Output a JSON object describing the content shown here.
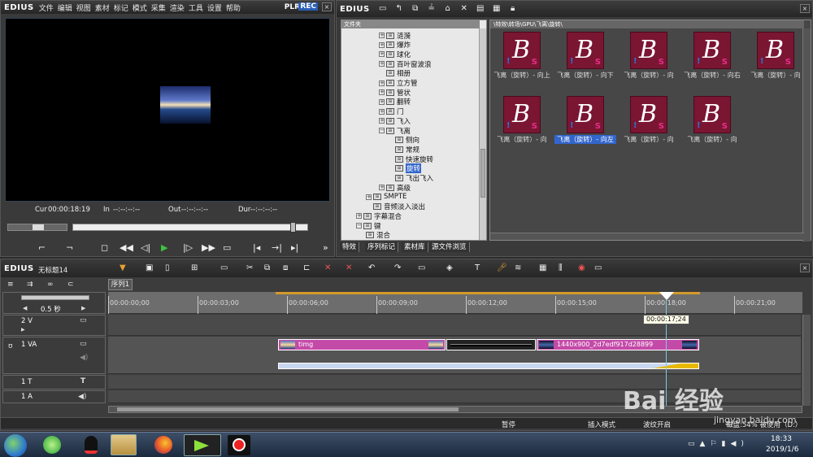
{
  "app": {
    "logo": "EDIUS"
  },
  "player": {
    "menu": [
      "文件",
      "编辑",
      "视图",
      "素材",
      "标记",
      "模式",
      "采集",
      "渲染",
      "工具",
      "设置",
      "帮助"
    ],
    "plr": "PLR",
    "rec": "REC",
    "cur_label": "Cur",
    "cur_value": "00:00:18:19",
    "in_label": "In",
    "in_value": "--:--:--:--",
    "out_label": "Out",
    "out_value": "--:--:--:--",
    "dur_label": "Dur",
    "dur_value": "--:--:--:--",
    "more": "»"
  },
  "bin": {
    "folder_header": "文件夹",
    "path": "\\特效\\转场\\GPU\\飞离\\旋转\\",
    "tree": [
      {
        "label": "涟漪",
        "type": "plus"
      },
      {
        "label": "爆炸",
        "type": "plus"
      },
      {
        "label": "球化",
        "type": "plus"
      },
      {
        "label": "百叶窗波浪",
        "type": "plus"
      },
      {
        "label": "相册",
        "type": "none"
      },
      {
        "label": "立方管",
        "type": "plus"
      },
      {
        "label": "管状",
        "type": "plus"
      },
      {
        "label": "翻转",
        "type": "plus"
      },
      {
        "label": "门",
        "type": "plus"
      },
      {
        "label": "飞入",
        "type": "plus"
      },
      {
        "label": "飞离",
        "type": "minus"
      },
      {
        "label": "侧向",
        "type": "child"
      },
      {
        "label": "常规",
        "type": "child"
      },
      {
        "label": "快速旋转",
        "type": "child"
      },
      {
        "label": "旋转",
        "type": "child-selected"
      },
      {
        "label": "飞出飞入",
        "type": "child"
      },
      {
        "label": "高级",
        "type": "plus"
      },
      {
        "label": "SMPTE",
        "type": "plus-top"
      },
      {
        "label": "音频淡入淡出",
        "type": "top"
      },
      {
        "label": "字幕混合",
        "type": "plus-root"
      },
      {
        "label": "键",
        "type": "minus-root"
      },
      {
        "label": "混合",
        "type": "root-child"
      }
    ],
    "thumbnails": [
      {
        "caption": "飞离（旋转）- 向上"
      },
      {
        "caption": "飞离（旋转）- 向下"
      },
      {
        "caption": "飞离（旋转）- 向"
      },
      {
        "caption": "飞离（旋转）- 向右"
      },
      {
        "caption": "飞离（旋转）- 向"
      },
      {
        "caption": "飞离（旋转）- 向"
      },
      {
        "caption": "飞离（旋转）- 向左"
      },
      {
        "caption": "飞离（旋转）- 向"
      },
      {
        "caption": "飞离（旋转）- 向"
      }
    ],
    "tabs": [
      "特效",
      "序列标记",
      "素材库",
      "源文件浏览"
    ],
    "selected_thumbnail_index": 6
  },
  "timeline": {
    "project_name": "无标题14",
    "sequence_tab": "序列1",
    "scale": "0.5 秒",
    "ruler": [
      "00:00:00;00",
      "00:00:03;00",
      "00:00:06;00",
      "00:00:09;00",
      "00:00:12;00",
      "00:00:15;00",
      "00:00:18;00",
      "00:00:21;00"
    ],
    "cursor_tooltip": "00:00:17;24",
    "tracks": [
      {
        "name": "2 V"
      },
      {
        "name": "1 VA"
      },
      {
        "name": "1 T"
      },
      {
        "name": "1 A"
      }
    ],
    "clip1_label": "timg",
    "clip2_label": "1440x900_2d7edf917d28899",
    "status": {
      "pause": "暂停",
      "insert_mode": "插入模式",
      "ripple": "波纹开启",
      "disk": "磁盘:54% 被使用（D:）"
    }
  },
  "taskbar": {
    "time": "18:33",
    "date": "2019/1/6"
  },
  "watermark": {
    "text": "Bai 经验",
    "url": "jingyan.baidu.com"
  },
  "colors": {
    "rec_badge": "#2a5db5",
    "thumbnail_bg": "#7a1532",
    "clip_magenta": "#c44aa8",
    "timeline_cursor": "#7ec8e3",
    "selection_blue": "#3366cc"
  }
}
